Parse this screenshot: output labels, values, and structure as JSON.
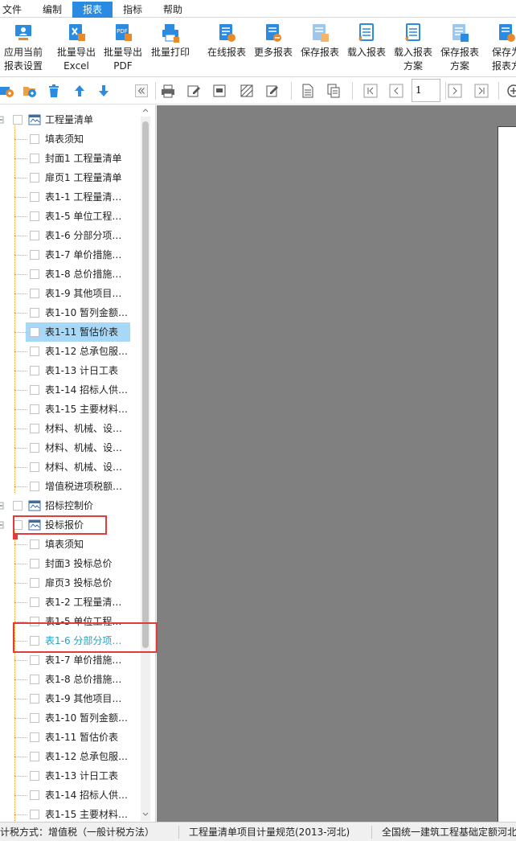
{
  "menu": {
    "file": "文件▾",
    "edit": "编制",
    "report": "报表",
    "indicator": "指标",
    "help": "帮助"
  },
  "ribbon": {
    "apply_current": "应用当前\n报表设置",
    "export_excel": "批量导出\nExcel",
    "export_pdf": "批量导出\nPDF",
    "batch_print": "批量打印",
    "online_reports": "在线报表",
    "more_reports": "更多报表",
    "save_report": "保存报表",
    "load_report": "载入报表",
    "load_scheme": "载入报表\n方案",
    "save_scheme": "保存报表\n方案",
    "save_as": "保存为\n报表方"
  },
  "pager": {
    "current_page": "1"
  },
  "tree": {
    "group1": {
      "title": "工程量清单",
      "items": [
        "填表须知",
        "封面1 工程量清单",
        "扉页1 工程量清单",
        "表1-1 工程量清…",
        "表1-5 单位工程…",
        "表1-6 分部分项…",
        "表1-7 单价措施…",
        "表1-8 总价措施…",
        "表1-9 其他项目…",
        "表1-10 暂列金额…",
        "表1-11 暂估价表",
        "表1-12 总承包服…",
        "表1-13 计日工表",
        "表1-14 招标人供…",
        "表1-15 主要材料…",
        "材料、机械、设…",
        "材料、机械、设…",
        "材料、机械、设…",
        "增值税进项税额…"
      ]
    },
    "group2": {
      "title": "招标控制价"
    },
    "group3": {
      "title": "投标报价",
      "items": [
        "填表须知",
        "封面3 投标总价",
        "扉页3 投标总价",
        "表1-2 工程量清…",
        "表1-5 单位工程…",
        "表1-6 分部分项…",
        "表1-7 单价措施…",
        "表1-8 总价措施…",
        "表1-9 其他项目…",
        "表1-10 暂列金额…",
        "表1-11 暂估价表",
        "表1-12 总承包服…",
        "表1-13 计日工表",
        "表1-14 招标人供…",
        "表1-15 主要材料…"
      ]
    }
  },
  "status": {
    "tax_method": "计税方式：增值税（一般计税方法）",
    "spec": "工程量清单项目计量规范(2013-河北)",
    "quota": "全国统一建筑工程基础定额河北"
  },
  "colors": {
    "accent": "#2b8be0",
    "selected_row": "#a8d8f8",
    "highlight_box": "#e23b3b",
    "tree_line": "#e8a24a",
    "preview_bg": "#808080"
  }
}
